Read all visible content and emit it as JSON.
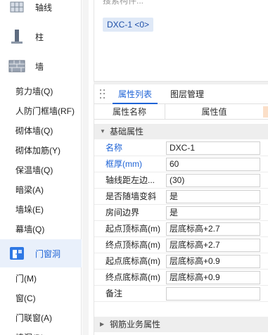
{
  "left_nav": {
    "categories": [
      {
        "label": "轴线",
        "icon": "axis-grid-icon"
      },
      {
        "label": "柱",
        "icon": "column-icon"
      },
      {
        "label": "墙",
        "icon": "brick-wall-icon"
      }
    ],
    "wall_items": [
      "剪力墙(Q)",
      "人防门框墙(RF)",
      "砌体墙(Q)",
      "砌体加筋(Y)",
      "保温墙(Q)",
      "暗梁(A)",
      "墙垛(E)",
      "幕墙(Q)"
    ],
    "active_category": {
      "label": "门窗洞",
      "icon": "door-window-icon"
    },
    "door_items": [
      "门(M)",
      "窗(C)",
      "门联窗(A)",
      "墙洞(D)"
    ]
  },
  "component_list": {
    "search_placeholder": "搜索构件...",
    "selected_chip": "DXC-1 <0>"
  },
  "properties": {
    "tabs": [
      "属性列表",
      "图层管理"
    ],
    "active_tab": 0,
    "columns": [
      "属性名称",
      "属性值"
    ],
    "groups": [
      {
        "label": "基础属性",
        "expanded": true,
        "rows": [
          {
            "name": "名称",
            "value": "DXC-1",
            "highlight": true
          },
          {
            "name": "框厚(mm)",
            "value": "60",
            "highlight": true
          },
          {
            "name": "轴线距左边...",
            "value": "(30)",
            "highlight": false
          },
          {
            "name": "是否随墙变斜",
            "value": "是",
            "highlight": false
          },
          {
            "name": "房间边界",
            "value": "是",
            "highlight": false
          },
          {
            "name": "起点顶标高(m)",
            "value": "层底标高+2.7",
            "highlight": false
          },
          {
            "name": "终点顶标高(m)",
            "value": "层底标高+2.7",
            "highlight": false
          },
          {
            "name": "起点底标高(m)",
            "value": "层底标高+0.9",
            "highlight": false
          },
          {
            "name": "终点底标高(m)",
            "value": "层底标高+0.9",
            "highlight": false
          },
          {
            "name": "备注",
            "value": "",
            "highlight": false
          }
        ]
      },
      {
        "label": "钢筋业务属性",
        "expanded": false,
        "rows": []
      }
    ]
  },
  "colors": {
    "accent": "#1e63d6",
    "active_bg": "#e9f0fb",
    "chip_bg": "#dfe9f7"
  }
}
